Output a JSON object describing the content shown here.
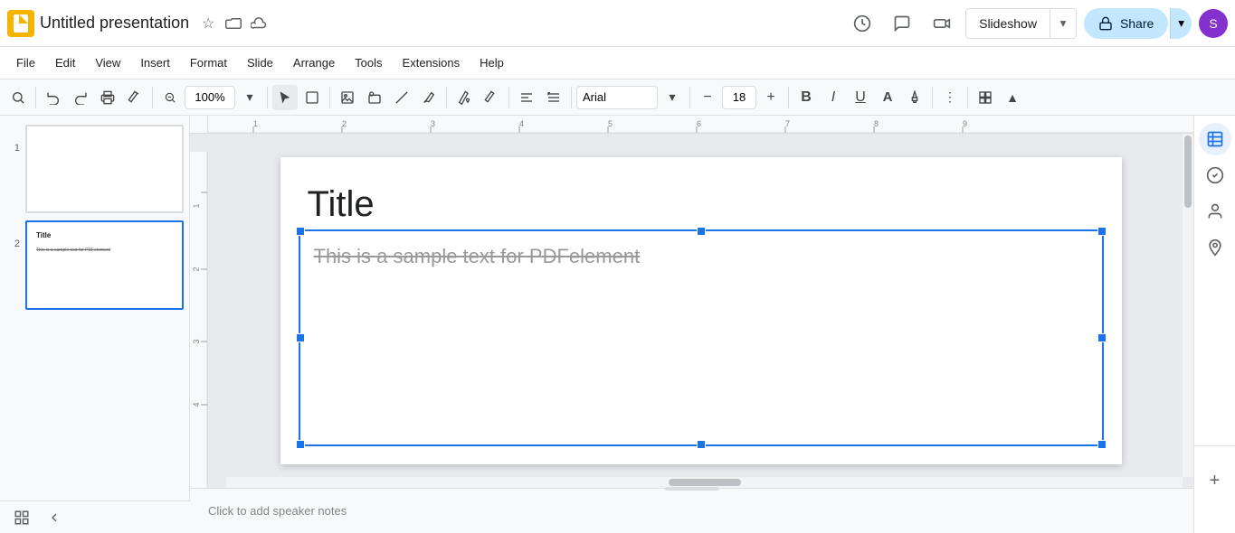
{
  "app": {
    "logo_color": "#f4b400",
    "title": "Untitled presentation"
  },
  "title_bar": {
    "doc_title": "Untitled presentation",
    "star_icon": "☆",
    "folder_icon": "📁",
    "cloud_icon": "☁",
    "history_icon": "🕐",
    "comment_icon": "💬",
    "camera_icon": "📷",
    "slideshow_label": "Slideshow",
    "slideshow_arrow": "▾",
    "share_icon": "🔒",
    "share_label": "Share",
    "share_arrow": "▾",
    "user_avatar": "S",
    "user_avatar_color": "#8430ce"
  },
  "menu": {
    "items": [
      "File",
      "Edit",
      "View",
      "Insert",
      "Format",
      "Slide",
      "Arrange",
      "Tools",
      "Extensions",
      "Help"
    ]
  },
  "toolbar": {
    "search_icon": "🔍",
    "zoom_value": "100%",
    "pointer_icon": "↖",
    "select_icon": "⊡",
    "image_icon": "🖼",
    "shape_icon": "⬡",
    "line_icon": "╱",
    "scribble_icon": "✎",
    "paintbucket_icon": "🪣",
    "pen_icon": "✒",
    "align_icon": "☰",
    "more_icon": "⋮⋮",
    "font_family": "Arial",
    "font_arrow": "▾",
    "font_size": "18",
    "bold_label": "B",
    "italic_label": "I",
    "underline_label": "U",
    "textcolor_icon": "A",
    "highlight_icon": "✏",
    "more_format": "⋯",
    "plus_icon": "+",
    "minus_icon": "−"
  },
  "slides": [
    {
      "number": "1",
      "title": "",
      "body": "",
      "active": false
    },
    {
      "number": "2",
      "title": "Title",
      "body": "This is a sample text for PDFelement",
      "active": true
    }
  ],
  "canvas": {
    "title_text": "Title",
    "body_text": "This is a sample text for PDFelement",
    "ruler_labels_h": [
      "1",
      "2",
      "3",
      "4",
      "5",
      "6",
      "7",
      "8",
      "9"
    ],
    "ruler_labels_v": [
      "1",
      "2",
      "3",
      "4"
    ]
  },
  "speaker_notes": {
    "placeholder": "Click to add speaker notes"
  },
  "right_sidebar": {
    "icon1": "📋",
    "icon2": "✓",
    "icon3": "👤",
    "icon4": "📍",
    "plus_icon": "+"
  },
  "bottom_bar": {
    "grid_icon": "⊞",
    "collapse_icon": "◂"
  },
  "colors": {
    "accent": "#1a73e8",
    "brand_yellow": "#f4b400",
    "active_slide_border": "#1a73e8",
    "handle_color": "#1a73e8",
    "text_color": "#202124"
  }
}
